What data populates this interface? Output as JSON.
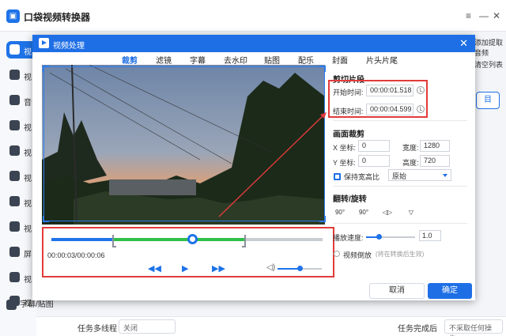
{
  "app": {
    "title": "口袋视频转换器",
    "window_controls": [
      "≡",
      "—",
      "✕"
    ]
  },
  "sidebar": {
    "items": [
      {
        "label": "视"
      },
      {
        "label": "视"
      },
      {
        "label": "音"
      },
      {
        "label": "视"
      },
      {
        "label": "视"
      },
      {
        "label": "视"
      },
      {
        "label": "视"
      },
      {
        "label": "视"
      },
      {
        "label": "屏"
      },
      {
        "label": "视"
      },
      {
        "label": "视"
      }
    ],
    "last_label": "字幕/贴图"
  },
  "right_peek": {
    "top_text": "添加提取音频",
    "mid_text": "清空列表",
    "button": "目"
  },
  "bottom_bar": {
    "multitask_label": "任务多线程",
    "multitask_value": "关闭",
    "done_label": "任务完成后",
    "done_value": "不采取任何操作"
  },
  "dialog": {
    "title": "视频处理",
    "close": "✕",
    "tabs": [
      "裁剪",
      "滤镜",
      "字幕",
      "去水印",
      "贴图",
      "配乐",
      "封面",
      "片头片尾"
    ],
    "active_tab": "裁剪",
    "timeline": {
      "timecode": "00:00:03/00:00:06",
      "progress_fraction": 0.52,
      "clip_start_fraction": 0.23,
      "clip_end_fraction": 0.71,
      "volume_fraction": 0.5
    },
    "clip": {
      "section_title": "剪切片段",
      "start_label": "开始时间:",
      "start_value": "00:00:01.518",
      "end_label": "结束时间:",
      "end_value": "00:00:04.599"
    },
    "crop": {
      "section_title": "画面裁剪",
      "x_label": "X 坐标:",
      "x_value": "0",
      "width_label": "宽度:",
      "width_value": "1280",
      "y_label": "Y 坐标:",
      "y_value": "0",
      "height_label": "高度:",
      "height_value": "720",
      "keep_ratio_label": "保持宽高比",
      "ratio_value": "原始"
    },
    "rotate": {
      "section_title": "翻转/旋转",
      "buttons": [
        "90°",
        "90°",
        "◁▷",
        "▽"
      ]
    },
    "speed": {
      "label": "播放速度:",
      "value": "1.0",
      "fraction": 0.25
    },
    "reverse": {
      "label": "视频倒放",
      "note": "(将在转换后生效)"
    },
    "cancel_label": "取消",
    "ok_label": "确定"
  },
  "colors": {
    "accent": "#1e6fe6",
    "highlight_box": "#e23b3b",
    "clip_range": "#2fbf4a"
  }
}
